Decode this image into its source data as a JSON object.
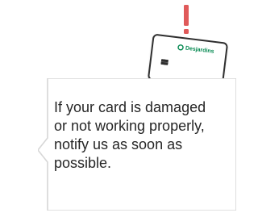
{
  "card": {
    "brand": "Desjardins",
    "brand_color": "#00874e"
  },
  "alert": {
    "icon": "exclamation-icon",
    "color": "#e05a5a"
  },
  "message": {
    "text": "If your card is damaged or not working properly, notify us as soon as possible."
  }
}
